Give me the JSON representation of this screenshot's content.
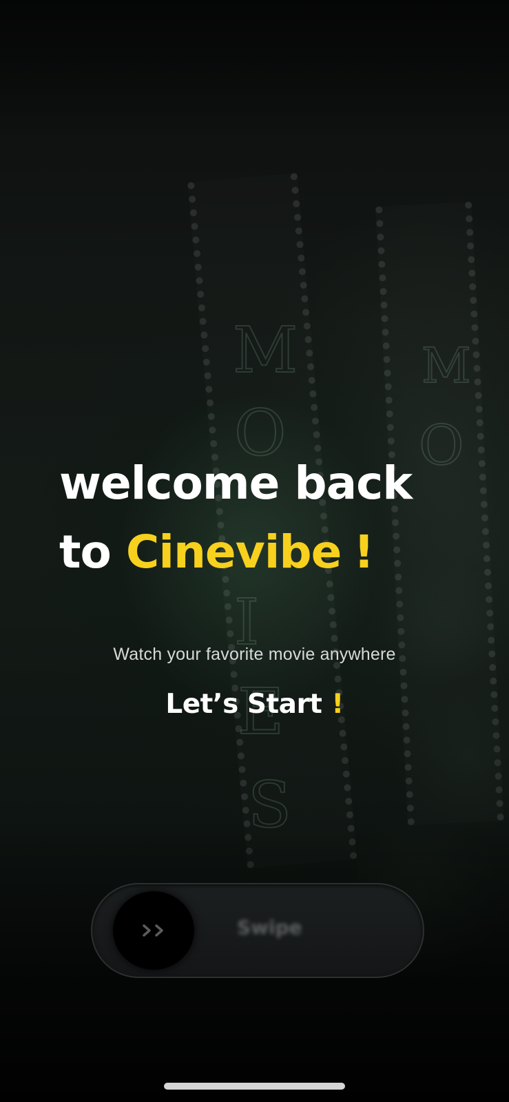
{
  "headline": {
    "line1": "welcome back",
    "line2_prefix": "to",
    "brand": "Cinevibe",
    "exclamation": "!"
  },
  "subtitle": "Watch your favorite movie anywhere",
  "cta": {
    "text": "Let’s Start",
    "exclamation": "!"
  },
  "swipe": {
    "label": "Swipe",
    "knob_icon": "double-chevron-right-icon"
  },
  "colors": {
    "accent": "#f7d11e",
    "background": "#0e1411",
    "text": "#ffffff"
  }
}
